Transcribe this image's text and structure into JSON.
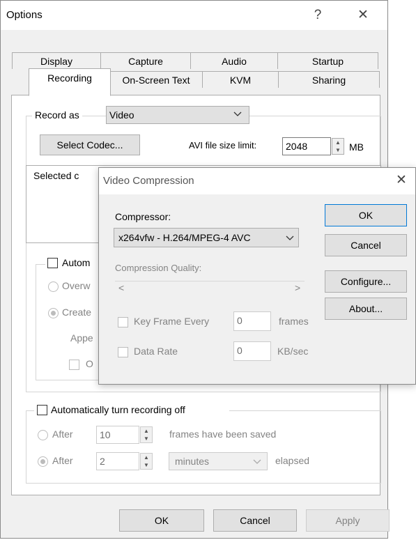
{
  "options": {
    "title": "Options",
    "help_glyph": "?",
    "close_glyph": "✕",
    "tabs_row1": [
      "Display",
      "Capture",
      "Audio",
      "Startup"
    ],
    "tabs_row2": [
      "Recording",
      "On-Screen Text",
      "KVM",
      "Sharing"
    ],
    "selected_tab": "Recording",
    "record_as_label": "Record as",
    "record_as_value": "Video",
    "select_codec_label": "Select Codec...",
    "avi_limit_label": "AVI file size limit:",
    "avi_limit_value": "2048",
    "avi_limit_unit": "MB",
    "selected_codec_text": "Selected c",
    "auto_partial": "Autom",
    "overwrite_partial": "Overw",
    "create_partial": "Create",
    "append_partial": "Appe",
    "sub_chk_partial": "O",
    "auto_off_label": "Automatically turn recording off",
    "after1_label": "After",
    "after1_value": "10",
    "after1_suffix": "frames have been saved",
    "after2_label": "After",
    "after2_value": "2",
    "after2_unit": "minutes",
    "after2_suffix": "elapsed",
    "ok": "OK",
    "cancel": "Cancel",
    "apply": "Apply"
  },
  "video_compression": {
    "title": "Video Compression",
    "close_glyph": "✕",
    "compressor_label": "Compressor:",
    "compressor_value": "x264vfw - H.264/MPEG-4 AVC",
    "quality_label": "Compression Quality:",
    "key_frame_label": "Key Frame Every",
    "key_frame_value": "0",
    "key_frame_unit": "frames",
    "data_rate_label": "Data Rate",
    "data_rate_value": "0",
    "data_rate_unit": "KB/sec",
    "ok": "OK",
    "cancel": "Cancel",
    "configure": "Configure...",
    "about": "About..."
  },
  "icons": {
    "chevron_down": "chevron-down-icon",
    "spin_up": "▲",
    "spin_down": "▼",
    "scroll_left": "<",
    "scroll_right": ">"
  }
}
